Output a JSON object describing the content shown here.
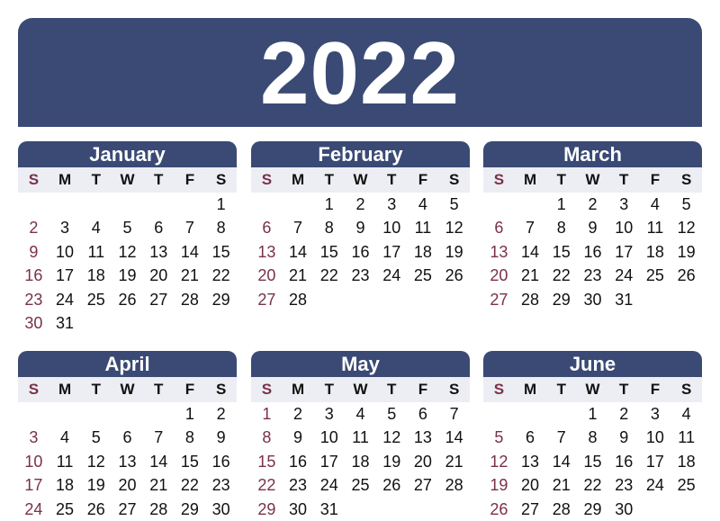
{
  "year": "2022",
  "weekday_labels": [
    "S",
    "M",
    "T",
    "W",
    "T",
    "F",
    "S"
  ],
  "months": [
    {
      "name": "January",
      "start": 6,
      "days": 31
    },
    {
      "name": "February",
      "start": 2,
      "days": 28
    },
    {
      "name": "March",
      "start": 2,
      "days": 31
    },
    {
      "name": "April",
      "start": 5,
      "days": 30
    },
    {
      "name": "May",
      "start": 0,
      "days": 31
    },
    {
      "name": "June",
      "start": 3,
      "days": 30
    }
  ],
  "colors": {
    "banner": "#3a4a75",
    "weekday_bg": "#eceef3",
    "sunday": "#7a3148",
    "text": "#111111"
  }
}
